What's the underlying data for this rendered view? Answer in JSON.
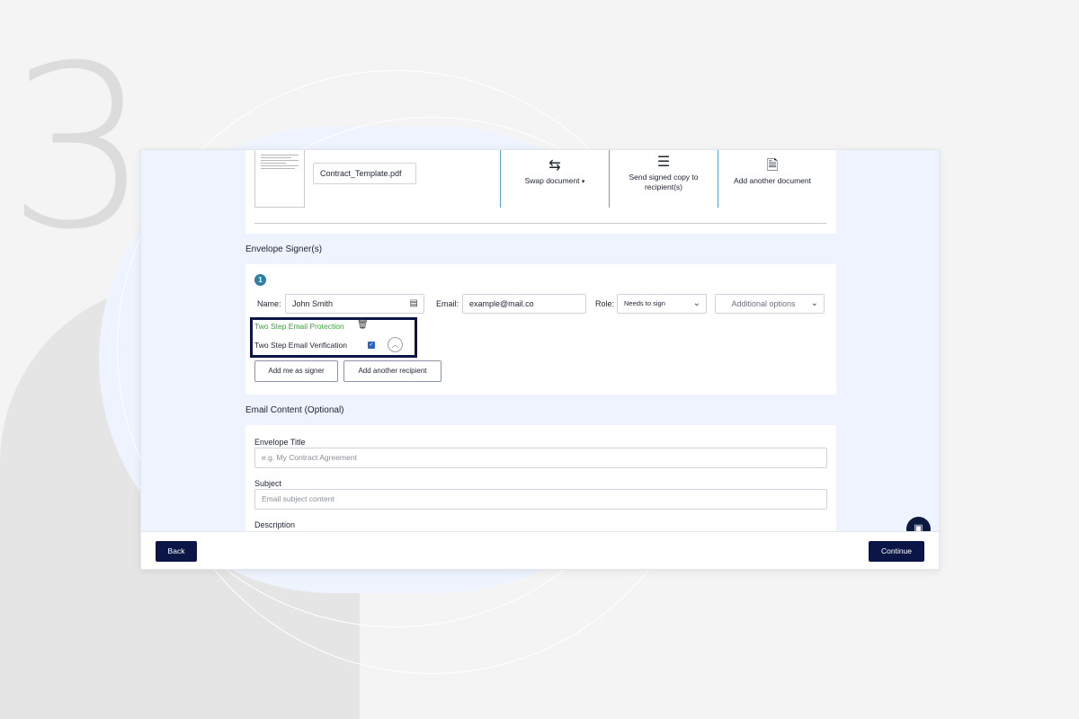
{
  "background": {
    "step_digit": "3"
  },
  "document": {
    "file_name": "Contract_Template.pdf",
    "actions": [
      {
        "label": "Swap document",
        "icon": "swap-arrows-icon"
      },
      {
        "label": "Send signed copy to recipient(s)",
        "icon": "lines-icon"
      },
      {
        "label": "Add another document",
        "icon": "add-document-icon"
      }
    ]
  },
  "signers_section": {
    "title": "Envelope Signer(s)",
    "signer_number": "1",
    "name_label": "Name:",
    "name_value": "John Smith",
    "email_label": "Email:",
    "email_value": "example@mail.co",
    "role_label": "Role:",
    "role_value": "Needs to sign",
    "additional_options": "Additional options",
    "two_step_protection": "Two Step Email Protection",
    "two_step_verification": "Two Step Email Verification",
    "verification_checked": true,
    "add_me_button": "Add me as signer",
    "add_recipient_button": "Add another recipient"
  },
  "email_section": {
    "title": "Email Content (Optional)",
    "envelope_title_label": "Envelope Title",
    "envelope_title_placeholder": "e.g. My Contract Agreement",
    "subject_label": "Subject",
    "subject_placeholder": "Email subject content",
    "description_label": "Description"
  },
  "footer": {
    "back_label": "Back",
    "continue_label": "Continue"
  },
  "colors": {
    "primary_dark": "#0c1646",
    "link_green": "#3aa33a",
    "badge_blue": "#2e7fa6",
    "panel_bg": "#eef3fd"
  }
}
